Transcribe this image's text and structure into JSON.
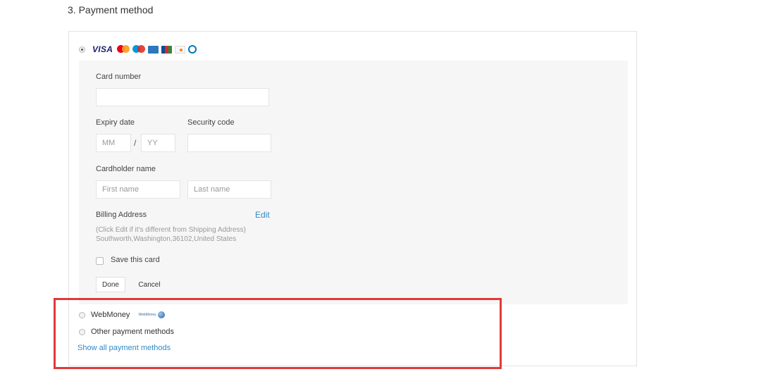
{
  "section": {
    "title": "3. Payment method"
  },
  "card_option": {
    "selected": true,
    "logos": [
      "VISA",
      "mastercard-icon",
      "maestro-icon",
      "amex-icon",
      "jcb-icon",
      "discover-icon",
      "diners-icon"
    ],
    "visa_label": "VISA"
  },
  "form": {
    "card_number_label": "Card number",
    "card_number_value": "",
    "expiry_label": "Expiry date",
    "expiry_month_placeholder": "MM",
    "expiry_separator": "/",
    "expiry_year_placeholder": "YY",
    "security_code_label": "Security code",
    "security_code_value": "",
    "cardholder_label": "Cardholder name",
    "first_name_placeholder": "First name",
    "last_name_placeholder": "Last name",
    "billing_label": "Billing Address",
    "edit_label": "Edit",
    "billing_hint": "(Click Edit if it's different from Shipping Address)",
    "billing_address": "Southworth,Washington,36102,United States",
    "save_card_label": "Save this card",
    "save_card_checked": false,
    "done_label": "Done",
    "cancel_label": "Cancel"
  },
  "alternatives": {
    "webmoney_label": "WebMoney",
    "webmoney_logo_text": "WebMoney",
    "other_label": "Other payment methods",
    "show_all_label": "Show all payment methods"
  },
  "colors": {
    "link": "#2e8bc9",
    "highlight": "#e03a3a",
    "form_bg": "#f6f6f6"
  }
}
